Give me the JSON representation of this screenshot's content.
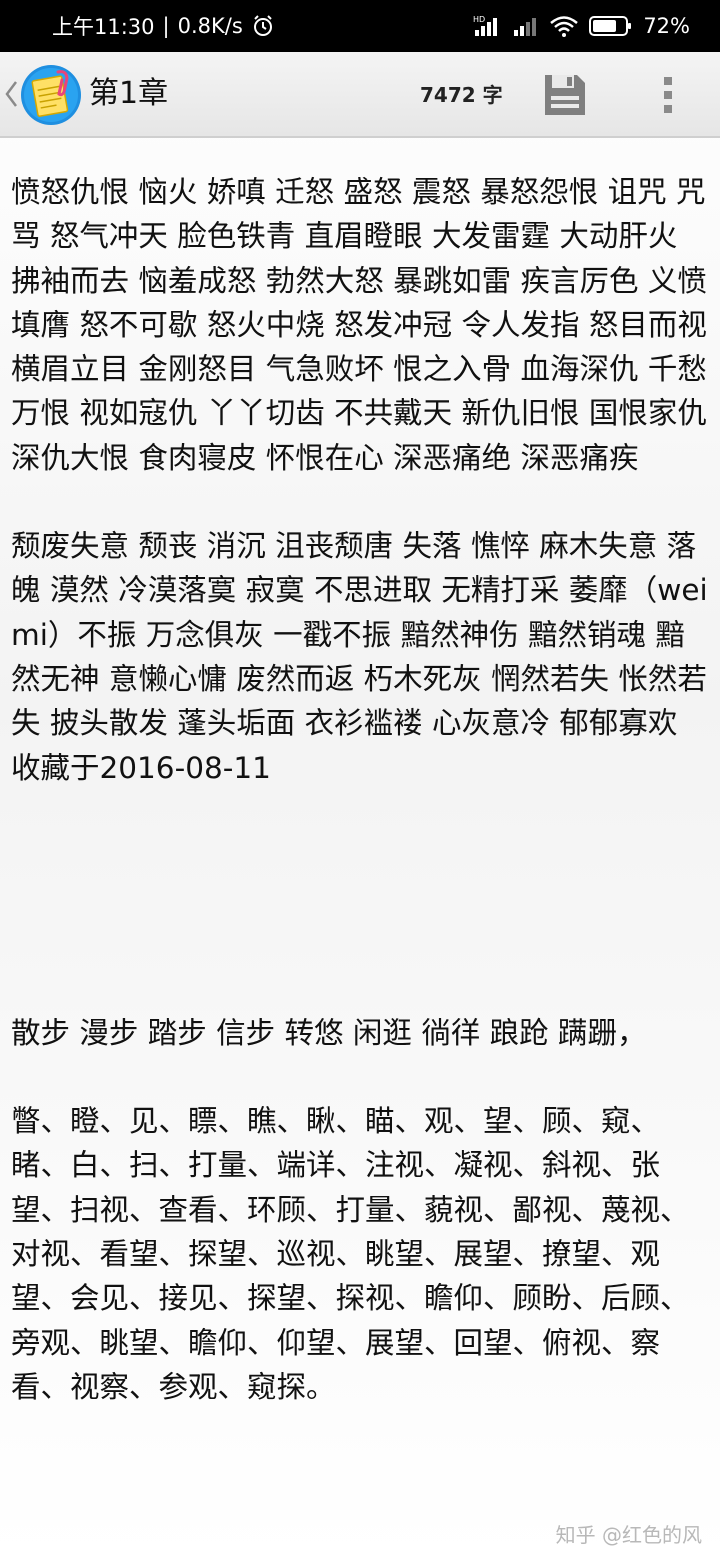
{
  "status_bar": {
    "time": "上午11:30",
    "network_speed": "0.8K/s",
    "separator": "|",
    "battery_percent": "72%",
    "icons": [
      "alarm-icon",
      "hd-signal-icon",
      "signal-icon",
      "wifi-icon",
      "battery-icon"
    ]
  },
  "toolbar": {
    "title": "第1章",
    "word_count": "7472 字",
    "icons": [
      "back-chevron-icon",
      "notepad-logo-icon",
      "save-icon",
      "more-vertical-icon"
    ]
  },
  "content": {
    "paragraphs": [
      "愤怒仇恨 恼火 娇嗔 迁怒 盛怒 震怒 暴怒怨恨 诅咒 咒骂 怒气冲天 脸色铁青 直眉瞪眼 大发雷霆 大动肝火 拂袖而去 恼羞成怒 勃然大怒 暴跳如雷 疾言厉色 义愤填膺 怒不可歇 怒火中烧 怒发冲冠 令人发指 怒目而视 横眉立目 金刚怒目 气急败坏 恨之入骨 血海深仇 千愁万恨 视如寇仇 丫丫切齿 不共戴天 新仇旧恨 国恨家仇 深仇大恨 食肉寝皮 怀恨在心 深恶痛绝 深恶痛疾",
      "颓废失意 颓丧 消沉 沮丧颓唐 失落 憔悴 麻木失意 落魄 漠然 冷漠落寞 寂寞 不思进取 无精打采 萎靡（wei mi）不振 万念俱灰 一戳不振 黯然神伤 黯然销魂 黯然无神 意懒心慵 废然而返 朽木死灰 惘然若失 怅然若失 披头散发 蓬头垢面 衣衫褴褛 心灰意冷 郁郁寡欢",
      "收藏于2016-08-11",
      "散步 漫步 踏步 信步 转悠 闲逛 徜徉 踉跄 蹒跚，",
      "瞥、瞪、见、瞟、瞧、瞅、瞄、观、望、顾、窥、睹、白、扫、打量、端详、注视、凝视、斜视、张望、扫视、查看、环顾、打量、藐视、鄙视、蔑视、对视、看望、探望、巡视、眺望、展望、撩望、观望、会见、接见、探望、探视、瞻仰、顾盼、后顾、旁观、眺望、瞻仰、仰望、展望、回望、俯视、察看、视察、参观、窥探。"
    ]
  },
  "watermark": "知乎 @红色的风"
}
